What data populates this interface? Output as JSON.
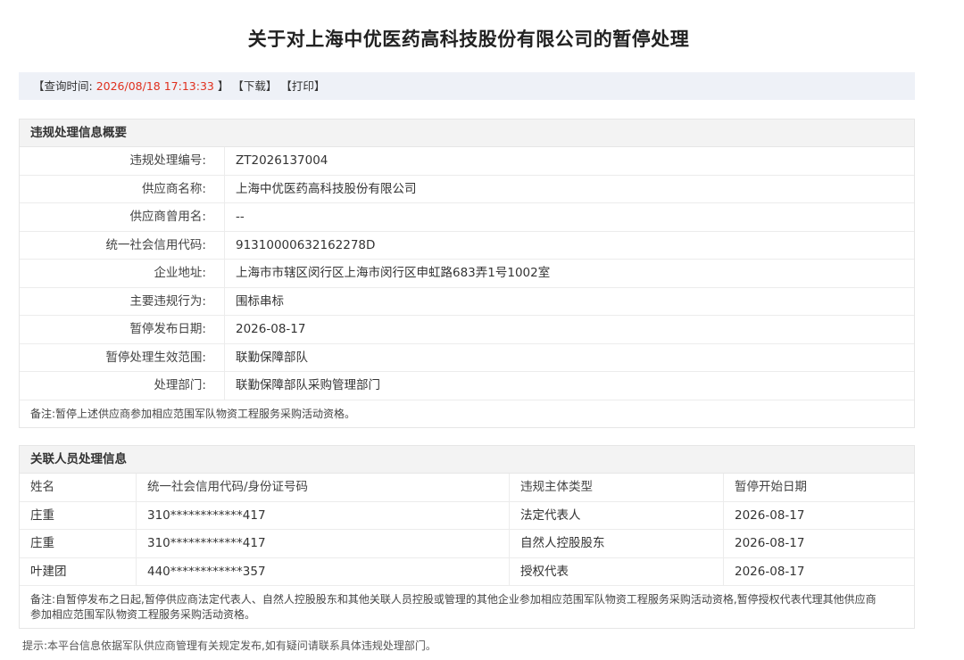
{
  "title": "关于对上海中优医药高科技股份有限公司的暂停处理",
  "toolbar": {
    "query_label_open": "【查询时间:",
    "query_time": "2026/08/18 17:13:33",
    "query_label_close": "】",
    "download": "【下载】",
    "print": "【打印】"
  },
  "summary": {
    "header": "违规处理信息概要",
    "rows": [
      {
        "label": "违规处理编号:",
        "value": "ZT2026137004"
      },
      {
        "label": "供应商名称:",
        "value": "上海中优医药高科技股份有限公司"
      },
      {
        "label": "供应商曾用名:",
        "value": "--"
      },
      {
        "label": "统一社会信用代码:",
        "value": "91310000632162278D"
      },
      {
        "label": "企业地址:",
        "value": "上海市市辖区闵行区上海市闵行区申虹路683弄1号1002室"
      },
      {
        "label": "主要违规行为:",
        "value": "围标串标"
      },
      {
        "label": "暂停发布日期:",
        "value": "2026-08-17"
      },
      {
        "label": "暂停处理生效范围:",
        "value": "联勤保障部队"
      },
      {
        "label": "处理部门:",
        "value": "联勤保障部队采购管理部门"
      }
    ],
    "note": "备注:暂停上述供应商参加相应范围军队物资工程服务采购活动资格。"
  },
  "related": {
    "header": "关联人员处理信息",
    "columns": [
      "姓名",
      "统一社会信用代码/身份证号码",
      "违规主体类型",
      "暂停开始日期"
    ],
    "rows": [
      [
        "庄重",
        "310************417",
        "法定代表人",
        "2026-08-17"
      ],
      [
        "庄重",
        "310************417",
        "自然人控股股东",
        "2026-08-17"
      ],
      [
        "叶建团",
        "440************357",
        "授权代表",
        "2026-08-17"
      ]
    ],
    "note_line1": "备注:自暂停发布之日起,暂停供应商法定代表人、自然人控股股东和其他关联人员控股或管理的其他企业参加相应范围军队物资工程服务采购活动资格,暂停授权代表代理其他供应商",
    "note_line2": "参加相应范围军队物资工程服务采购活动资格。"
  },
  "footer_tip": "提示:本平台信息依据军队供应商管理有关规定发布,如有疑问请联系具体违规处理部门。"
}
